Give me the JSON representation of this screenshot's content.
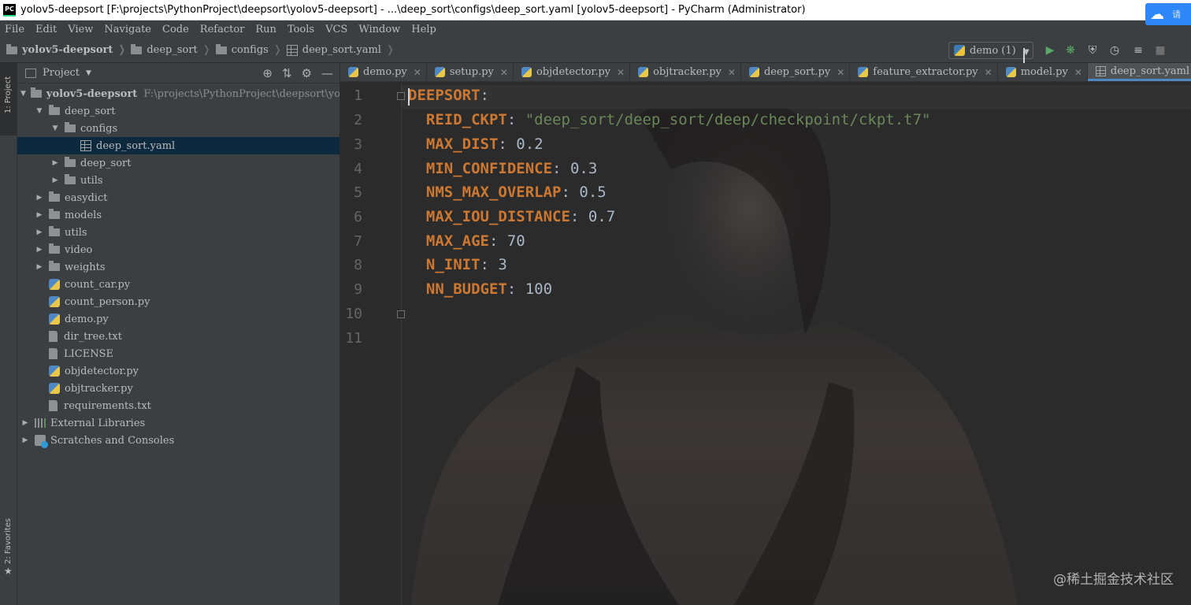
{
  "window": {
    "title": "yolov5-deepsort [F:\\projects\\PythonProject\\deepsort\\yolov5-deepsort] - ...\\deep_sort\\configs\\deep_sort.yaml [yolov5-deepsort] - PyCharm (Administrator)",
    "app_icon_text": "PC"
  },
  "menu": [
    "File",
    "Edit",
    "View",
    "Navigate",
    "Code",
    "Refactor",
    "Run",
    "Tools",
    "VCS",
    "Window",
    "Help"
  ],
  "badge": {
    "text": "请",
    "icon": "baidu-cloud-icon"
  },
  "breadcrumb": [
    "yolov5-deepsort",
    "deep_sort",
    "configs",
    "deep_sort.yaml"
  ],
  "run_config": {
    "label": "demo (1)"
  },
  "toolbar_icons": [
    "run-icon",
    "debug-icon",
    "coverage-icon",
    "profile-icon",
    "build-icon",
    "stop-icon"
  ],
  "left_strip": {
    "project_label": "1: Project",
    "favorites_label": "2: Favorites"
  },
  "project_panel": {
    "title": "Project",
    "root_name": "yolov5-deepsort",
    "root_path": "F:\\projects\\PythonProject\\deepsort\\yolo",
    "items": [
      {
        "label": "deep_sort"
      },
      {
        "label": "configs"
      },
      {
        "label": "deep_sort.yaml"
      },
      {
        "label": "deep_sort"
      },
      {
        "label": "utils"
      },
      {
        "label": "easydict"
      },
      {
        "label": "models"
      },
      {
        "label": "utils"
      },
      {
        "label": "video"
      },
      {
        "label": "weights"
      },
      {
        "label": "count_car.py"
      },
      {
        "label": "count_person.py"
      },
      {
        "label": "demo.py"
      },
      {
        "label": "dir_tree.txt"
      },
      {
        "label": "LICENSE"
      },
      {
        "label": "objdetector.py"
      },
      {
        "label": "objtracker.py"
      },
      {
        "label": "requirements.txt"
      },
      {
        "label": "External Libraries"
      },
      {
        "label": "Scratches and Consoles"
      }
    ]
  },
  "tabs": [
    "demo.py",
    "setup.py",
    "objdetector.py",
    "objtracker.py",
    "deep_sort.py",
    "feature_extractor.py",
    "model.py",
    "deep_sort.yaml"
  ],
  "editor": {
    "line_numbers": [
      "1",
      "2",
      "3",
      "4",
      "5",
      "6",
      "7",
      "8",
      "9",
      "10",
      "11"
    ],
    "lines": [
      {
        "key": "DEEPSORT",
        "value": ""
      },
      {
        "key": "REID_CKPT",
        "value": "\"deep_sort/deep_sort/deep/checkpoint/ckpt.t7\""
      },
      {
        "key": "MAX_DIST",
        "value": "0.2"
      },
      {
        "key": "MIN_CONFIDENCE",
        "value": "0.3"
      },
      {
        "key": "NMS_MAX_OVERLAP",
        "value": "0.5"
      },
      {
        "key": "MAX_IOU_DISTANCE",
        "value": "0.7"
      },
      {
        "key": "MAX_AGE",
        "value": "70"
      },
      {
        "key": "N_INIT",
        "value": "3"
      },
      {
        "key": "NN_BUDGET",
        "value": "100"
      }
    ]
  },
  "watermark": "@稀土掘金技术社区",
  "colors": {
    "keyword": "#cc7832",
    "string": "#6a8759",
    "number": "#a9b7c6",
    "selection": "#0d293e",
    "tab_underline": "#4a88c7"
  }
}
